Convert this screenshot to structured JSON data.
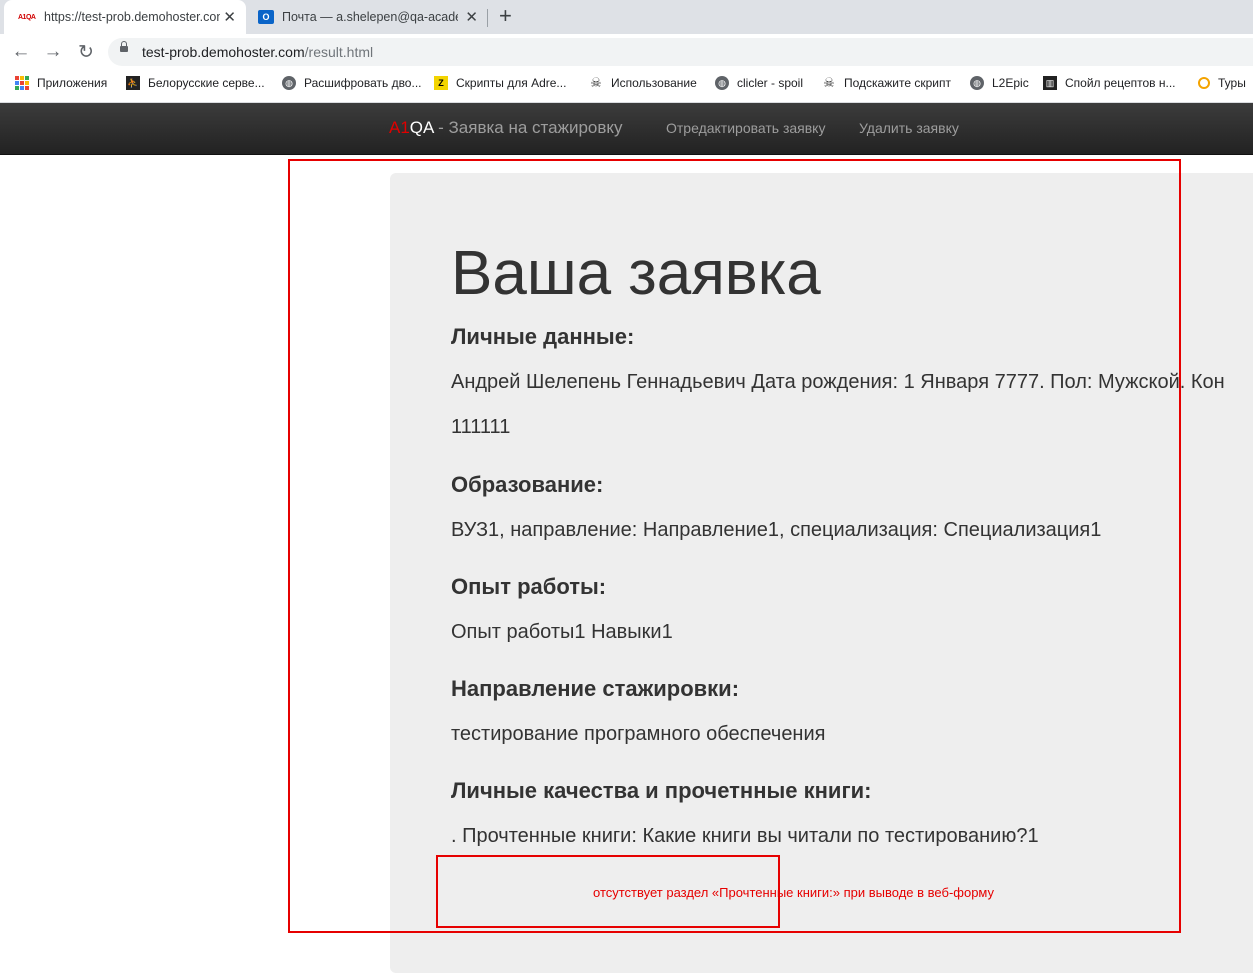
{
  "browser": {
    "tabs": [
      {
        "favicon": "A1QA",
        "title": "https://test-prob.demohoster.com",
        "active": true
      },
      {
        "favicon": "Outlook",
        "title": "Почта — a.shelepen@qa-academ",
        "active": false
      }
    ],
    "url": {
      "host": "test-prob.demohoster.com",
      "path": "/result.html"
    },
    "bookmarks": [
      {
        "icon": "apps-grid-icon",
        "label": "Приложения"
      },
      {
        "icon": "runner-icon",
        "label": "Белорусские серве..."
      },
      {
        "icon": "globe-icon",
        "label": "Расшифровать дво..."
      },
      {
        "icon": "bolt-icon",
        "label": "Скрипты для Adre..."
      },
      {
        "icon": "pirate-icon",
        "label": "Использование"
      },
      {
        "icon": "globe-icon",
        "label": "clicler - spoil"
      },
      {
        "icon": "pirate-icon",
        "label": "Подскажите скрипт"
      },
      {
        "icon": "globe-icon",
        "label": "L2Epic"
      },
      {
        "icon": "building-icon",
        "label": "Спойл рецептов н..."
      },
      {
        "icon": "ring-icon",
        "label": "Туры"
      }
    ]
  },
  "site_nav": {
    "brand_a1": "A1",
    "brand_qa": "QA",
    "brand_rest": " - Заявка на стажировку",
    "edit_link": "Отредактировать заявку",
    "delete_link": "Удалить заявку"
  },
  "main": {
    "heading": "Ваша заявка",
    "sections": [
      {
        "title": "Личные данные:",
        "lines": [
          "Андрей Шелепень Геннадьевич Дата рождения: 1 Января 7777. Пол: Мужской. Кон",
          "111111"
        ]
      },
      {
        "title": "Образование:",
        "lines": [
          "ВУЗ1, направление: Направление1, специализация: Специализация1"
        ]
      },
      {
        "title": "Опыт работы:",
        "lines": [
          "Опыт работы1 Навыки1"
        ]
      },
      {
        "title": "Направление стажировки:",
        "lines": [
          "тестирование програмного обеспечения"
        ]
      },
      {
        "title": "Личные качества и прочетнные книги:",
        "lines": [
          ". Прочтенные книги: Какие книги вы читали по тестированию?1"
        ]
      }
    ]
  },
  "annotation": {
    "note": "отсутствует раздел «Прочтенные книги:» при выводе в веб-форму",
    "color": "#e60000"
  }
}
